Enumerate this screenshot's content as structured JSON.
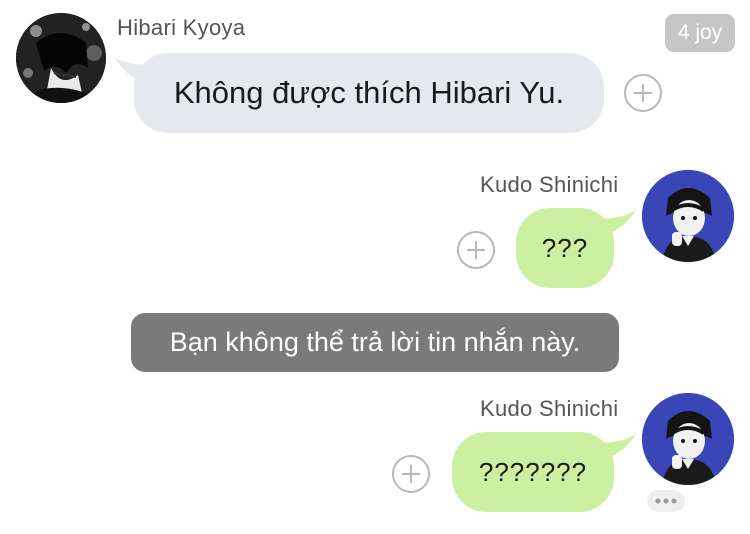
{
  "messages": [
    {
      "sender": "Hibari Kyoya",
      "text": "Không được thích Hibari Yu.",
      "badge": "4 joy"
    },
    {
      "sender": "Kudo Shinichi",
      "text": "???"
    },
    {
      "system_notice": "Bạn không thể trả lời tin nhắn này."
    },
    {
      "sender": "Kudo Shinichi",
      "text": "???????"
    }
  ],
  "colors": {
    "left_bubble": "#e5e8ec",
    "right_bubble": "#ccf0a2",
    "notice_bg": "#7a7a7a",
    "badge_bg": "#c6c6c6"
  },
  "icons": {
    "add_reaction": "plus-circle-icon",
    "typing": "ellipsis-icon"
  }
}
